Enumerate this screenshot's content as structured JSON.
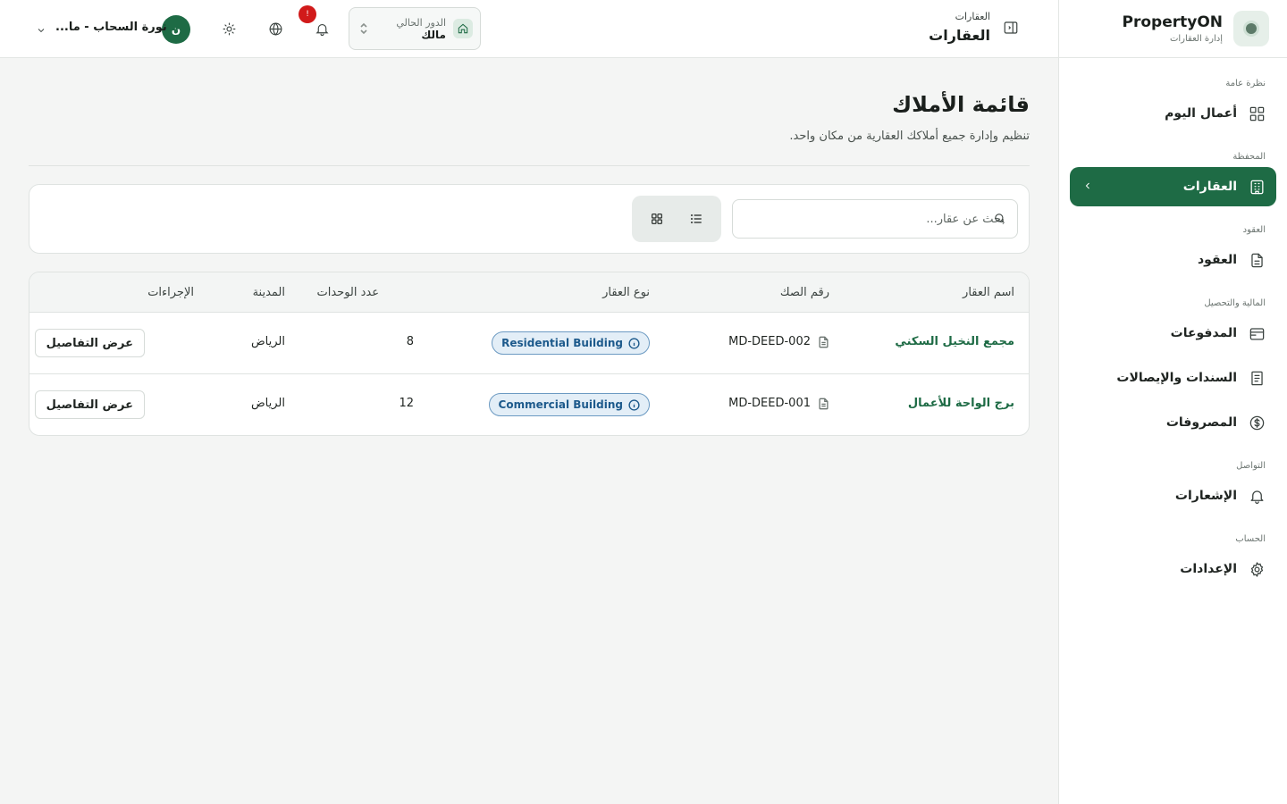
{
  "brand": {
    "name": "PropertyON",
    "subtitle": "إدارة العقارات"
  },
  "sidebar": {
    "sections": [
      {
        "label": "نظرة عامة",
        "items": [
          {
            "label": "أعمال اليوم",
            "icon": "grid-icon"
          }
        ]
      },
      {
        "label": "المحفظة",
        "items": [
          {
            "label": "العقارات",
            "icon": "building-icon",
            "active": true
          }
        ]
      },
      {
        "label": "العقود",
        "items": [
          {
            "label": "العقود",
            "icon": "document-icon"
          }
        ]
      },
      {
        "label": "المالية والتحصيل",
        "items": [
          {
            "label": "المدفوعات",
            "icon": "wallet-icon"
          },
          {
            "label": "السندات والإيصالات",
            "icon": "receipt-icon"
          },
          {
            "label": "المصروفات",
            "icon": "dollar-circle-icon"
          }
        ]
      },
      {
        "label": "التواصل",
        "items": [
          {
            "label": "الإشعارات",
            "icon": "bell-icon"
          }
        ]
      },
      {
        "label": "الحساب",
        "items": [
          {
            "label": "الإعدادات",
            "icon": "gear-icon"
          }
        ]
      }
    ]
  },
  "header": {
    "breadcrumb_small": "العقارات",
    "breadcrumb_title": "العقارات",
    "role_label": "الدور الحالي",
    "role_value": "مالك",
    "notification_count": "!",
    "user_initial": "ن",
    "user_name": "نورة السحاب - ما..."
  },
  "page": {
    "title": "قائمة الأملاك",
    "subtitle": "تنظيم وإدارة جميع أملاكك العقارية من مكان واحد."
  },
  "search": {
    "placeholder": "بحث عن عقار..."
  },
  "table": {
    "columns": {
      "name": "اسم العقار",
      "deed": "رقم الصك",
      "type": "نوع العقار",
      "units": "عدد الوحدات",
      "city": "المدينة",
      "actions": "الإجراءات"
    },
    "rows": [
      {
        "name": "مجمع النخيل السكني",
        "deed": "MD-DEED-002",
        "type": "Residential Building",
        "units": "8",
        "city": "الرياض",
        "action": "عرض التفاصيل"
      },
      {
        "name": "برج الواحة للأعمال",
        "deed": "MD-DEED-001",
        "type": "Commercial Building",
        "units": "12",
        "city": "الرياض",
        "action": "عرض التفاصيل"
      }
    ]
  },
  "colors": {
    "primary": "#1e6b45",
    "badge": "#d11a1a",
    "pill_bg": "#e3eef7",
    "pill_text": "#1d5a8c"
  }
}
